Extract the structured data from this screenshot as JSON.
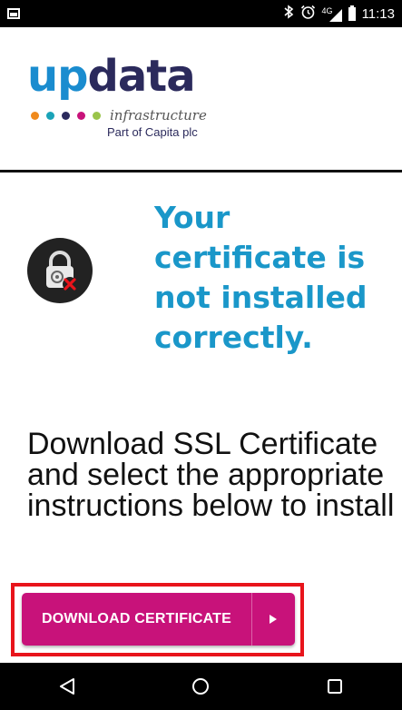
{
  "status_bar": {
    "time": "11:13",
    "network": "4G",
    "icons": [
      "gallery-icon",
      "bluetooth-icon",
      "alarm-icon",
      "signal-icon",
      "battery-icon"
    ]
  },
  "logo": {
    "word_up": "up",
    "word_data": "data",
    "tagline": "infrastructure",
    "sub": "Part of Capita plc",
    "dot_colors": [
      "#f08a1c",
      "#1aa3b8",
      "#2b2a5c",
      "#c8127a",
      "#9ac44a"
    ]
  },
  "alert": {
    "icon": "lock-error-icon",
    "headline": "Your certificate is not installed correctly."
  },
  "instructions": "Download SSL Certificate and select the appropriate instructions below to install",
  "download_button": {
    "label": "DOWNLOAD CERTIFICATE"
  },
  "nav": {
    "icons": [
      "back-icon",
      "home-icon",
      "recents-icon"
    ]
  },
  "colors": {
    "headline": "#1a97c9",
    "button": "#c8127a",
    "highlight": "#e8141b"
  }
}
